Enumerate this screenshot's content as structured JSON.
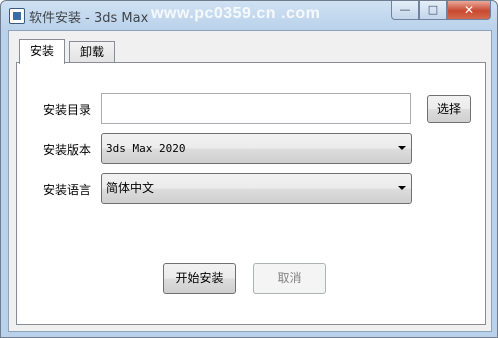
{
  "window": {
    "title": "软件安装 - 3ds Max",
    "watermark": "www.pc0359.cn  .com",
    "controls": {
      "minimize_glyph": "—",
      "maximize_glyph": "□",
      "close_glyph": "✕"
    }
  },
  "tabs": [
    {
      "label": "安装",
      "active": true
    },
    {
      "label": "卸载",
      "active": false
    }
  ],
  "form": {
    "install_dir": {
      "label": "安装目录",
      "value": "",
      "browse_label": "选择"
    },
    "version": {
      "label": "安装版本",
      "value": "3ds Max 2020"
    },
    "language": {
      "label": "安装语言",
      "value": "简体中文"
    }
  },
  "actions": {
    "start_label": "开始安装",
    "cancel_label": "取消"
  }
}
